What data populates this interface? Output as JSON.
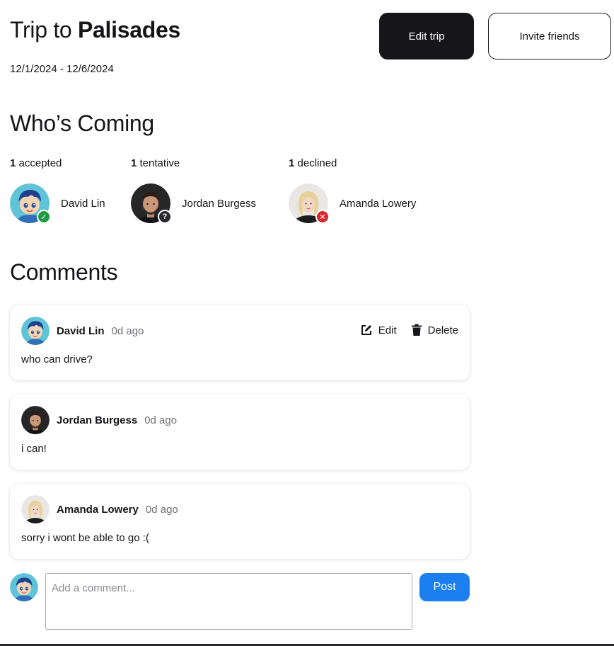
{
  "trip": {
    "title_prefix": "Trip to",
    "title_place": "Palisades",
    "dates": "12/1/2024 - 12/6/2024"
  },
  "header_buttons": {
    "edit": "Edit trip",
    "invite": "Invite friends"
  },
  "whos_coming": {
    "heading": "Who’s Coming",
    "groups": [
      {
        "count": "1",
        "status": "accepted",
        "person": "David Lin",
        "badge": "✓",
        "avatar": "cartoon-boy-avatar"
      },
      {
        "count": "1",
        "status": "tentative",
        "person": "Jordan Burgess",
        "badge": "?",
        "avatar": "man-photo-avatar"
      },
      {
        "count": "1",
        "status": "declined",
        "person": "Amanda Lowery",
        "badge": "✕",
        "avatar": "woman-photo-avatar"
      }
    ]
  },
  "comments": {
    "heading": "Comments",
    "items": [
      {
        "author": "David Lin",
        "time": "0d ago",
        "text": "who can drive?",
        "edit_label": "Edit",
        "delete_label": "Delete"
      },
      {
        "author": "Jordan Burgess",
        "time": "0d ago",
        "text": "i can!"
      },
      {
        "author": "Amanda Lowery",
        "time": "0d ago",
        "text": "sorry i wont be able to go :("
      }
    ]
  },
  "composer": {
    "placeholder": "Add a comment...",
    "post_label": "Post"
  },
  "colors": {
    "primary_dark": "#16161a",
    "accent_blue": "#1b7ff0",
    "accepted_green": "#1e9a3f",
    "declined_red": "#d9262c"
  }
}
